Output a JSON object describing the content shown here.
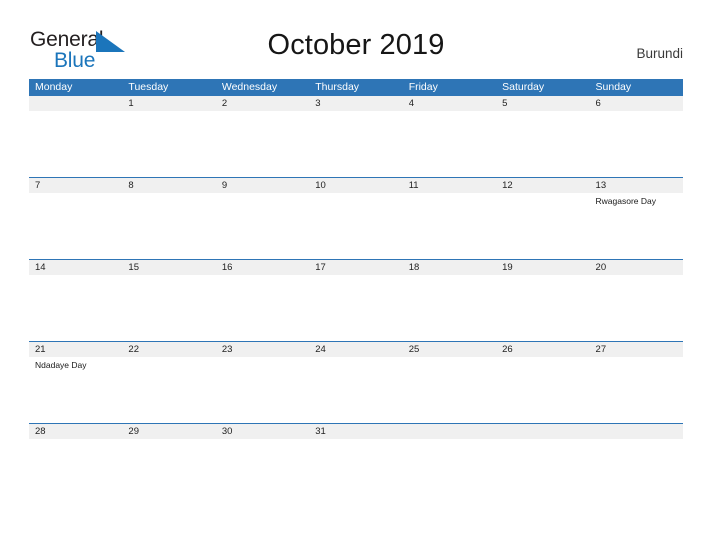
{
  "brand": {
    "name_part1": "General",
    "name_part2": "Blue",
    "flag_icon": "flag-triangle-icon",
    "accent_color": "#1b75bb"
  },
  "header": {
    "title": "October 2019",
    "country": "Burundi"
  },
  "theme": {
    "header_blue": "#2e75b6",
    "band_gray": "#f0f0f0",
    "text_dark": "#222222"
  },
  "calendar": {
    "weekdays": [
      "Monday",
      "Tuesday",
      "Wednesday",
      "Thursday",
      "Friday",
      "Saturday",
      "Sunday"
    ],
    "weeks": [
      {
        "days": [
          {
            "date": "",
            "event": ""
          },
          {
            "date": "1",
            "event": ""
          },
          {
            "date": "2",
            "event": ""
          },
          {
            "date": "3",
            "event": ""
          },
          {
            "date": "4",
            "event": ""
          },
          {
            "date": "5",
            "event": ""
          },
          {
            "date": "6",
            "event": ""
          }
        ]
      },
      {
        "days": [
          {
            "date": "7",
            "event": ""
          },
          {
            "date": "8",
            "event": ""
          },
          {
            "date": "9",
            "event": ""
          },
          {
            "date": "10",
            "event": ""
          },
          {
            "date": "11",
            "event": ""
          },
          {
            "date": "12",
            "event": ""
          },
          {
            "date": "13",
            "event": "Rwagasore Day"
          }
        ]
      },
      {
        "days": [
          {
            "date": "14",
            "event": ""
          },
          {
            "date": "15",
            "event": ""
          },
          {
            "date": "16",
            "event": ""
          },
          {
            "date": "17",
            "event": ""
          },
          {
            "date": "18",
            "event": ""
          },
          {
            "date": "19",
            "event": ""
          },
          {
            "date": "20",
            "event": ""
          }
        ]
      },
      {
        "days": [
          {
            "date": "21",
            "event": "Ndadaye Day"
          },
          {
            "date": "22",
            "event": ""
          },
          {
            "date": "23",
            "event": ""
          },
          {
            "date": "24",
            "event": ""
          },
          {
            "date": "25",
            "event": ""
          },
          {
            "date": "26",
            "event": ""
          },
          {
            "date": "27",
            "event": ""
          }
        ]
      },
      {
        "days": [
          {
            "date": "28",
            "event": ""
          },
          {
            "date": "29",
            "event": ""
          },
          {
            "date": "30",
            "event": ""
          },
          {
            "date": "31",
            "event": ""
          },
          {
            "date": "",
            "event": ""
          },
          {
            "date": "",
            "event": ""
          },
          {
            "date": "",
            "event": ""
          }
        ]
      }
    ]
  }
}
